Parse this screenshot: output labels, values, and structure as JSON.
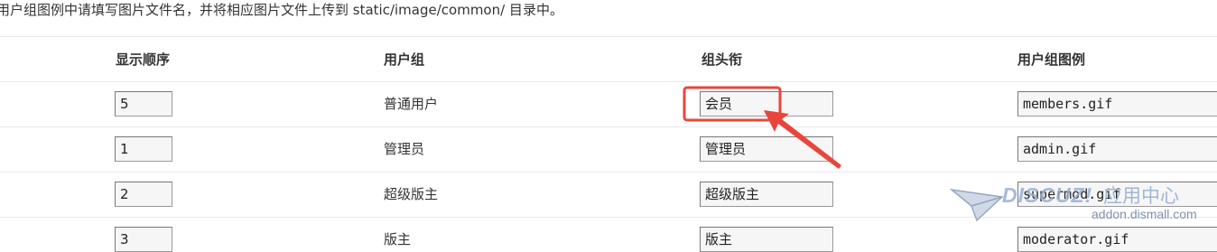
{
  "notice": "用户组图例中请填写图片文件名，并将相应图片文件上传到 static/image/common/ 目录中。",
  "columns": {
    "order": "显示顺序",
    "group": "用户组",
    "title": "组头衔",
    "icon": "用户组图例"
  },
  "rows": [
    {
      "order": "5",
      "group": "普通用户",
      "title": "会员",
      "icon": "members.gif"
    },
    {
      "order": "1",
      "group": "管理员",
      "title": "管理员",
      "icon": "admin.gif"
    },
    {
      "order": "2",
      "group": "超级版主",
      "title": "超级版主",
      "icon": "supermod.gif"
    },
    {
      "order": "3",
      "group": "版主",
      "title": "版主",
      "icon": "moderator.gif"
    }
  ],
  "annotation": {
    "color": "#e8463c"
  },
  "watermark": {
    "brand": "DISCUZ!",
    "label": "应用中心",
    "url": "addon.dismall.com"
  }
}
